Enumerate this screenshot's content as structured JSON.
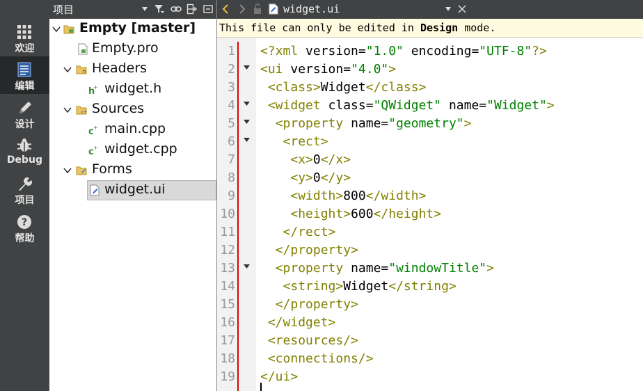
{
  "modes": [
    {
      "label": "欢迎",
      "icon": "grid-icon",
      "active": false
    },
    {
      "label": "编辑",
      "icon": "document-icon",
      "active": true
    },
    {
      "label": "设计",
      "icon": "pencil-icon",
      "active": false
    },
    {
      "label": "Debug",
      "icon": "bug-icon",
      "active": false
    },
    {
      "label": "项目",
      "icon": "wrench-icon",
      "active": false
    },
    {
      "label": "帮助",
      "icon": "help-icon",
      "active": false
    }
  ],
  "project_panel": {
    "title": "项目",
    "tree": [
      {
        "label": "Empty [master]",
        "bold": true,
        "icon": "project-folder-icon"
      },
      {
        "label": "Empty.pro",
        "icon": "pro-file-icon"
      },
      {
        "label": "Headers",
        "icon": "headers-folder-icon"
      },
      {
        "label": "widget.h",
        "icon": "header-file-icon"
      },
      {
        "label": "Sources",
        "icon": "sources-folder-icon"
      },
      {
        "label": "main.cpp",
        "icon": "cpp-file-icon"
      },
      {
        "label": "widget.cpp",
        "icon": "cpp-file-icon"
      },
      {
        "label": "Forms",
        "icon": "forms-folder-icon"
      },
      {
        "label": "widget.ui",
        "icon": "ui-file-icon",
        "selected": true
      }
    ]
  },
  "editor": {
    "filename": "widget.ui",
    "info_prefix": "This file can only be edited in ",
    "info_bold": "Design",
    "info_suffix": " mode.",
    "line_numbers": [
      "1",
      "2",
      "3",
      "4",
      "5",
      "6",
      "7",
      "8",
      "9",
      "10",
      "11",
      "12",
      "13",
      "14",
      "15",
      "16",
      "17",
      "18",
      "19"
    ],
    "colors": {
      "tag": "#808000",
      "value": "#008000",
      "marker": "#e00000",
      "info_bg": "#fffbe0"
    }
  }
}
